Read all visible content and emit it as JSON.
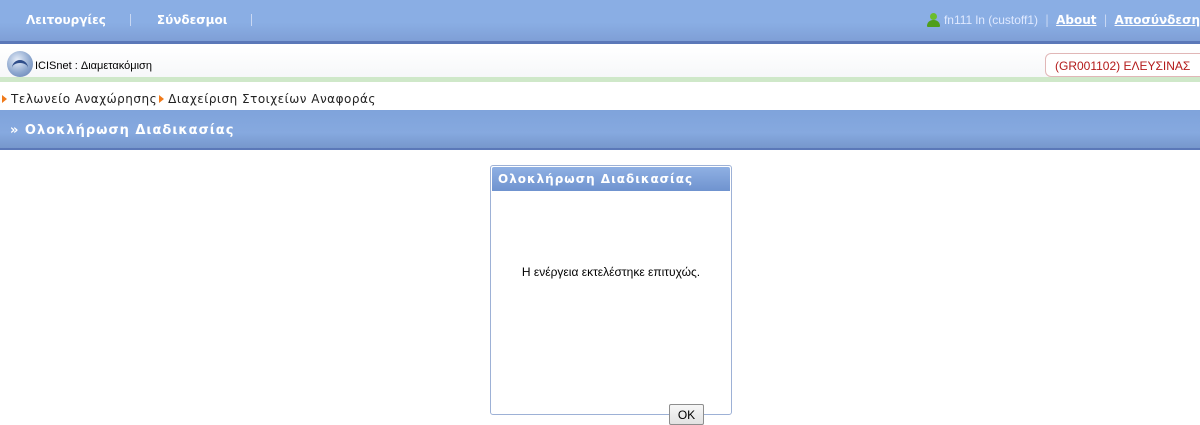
{
  "topbar": {
    "menu": [
      {
        "label": "Λειτουργίες"
      },
      {
        "label": "Σύνδεσμοι"
      }
    ],
    "user": "fn111 ln (custoff1)",
    "about": "About",
    "logout": "Αποσύνδεση"
  },
  "app": {
    "title": "ICISnet : Διαμετακόμιση",
    "office": "(GR001102) ΕΛΕΥΣΙΝΑΣ"
  },
  "breadcrumb": [
    "Τελωνείο Αναχώρησης",
    "Διαχείριση Στοιχείων Αναφοράς"
  ],
  "section": {
    "title": "» Ολοκλήρωση Διαδικασίας"
  },
  "dialog": {
    "title": "Ολοκλήρωση Διαδικασίας",
    "message": "Η ενέργεια εκτελέστηκε επιτυχώς.",
    "ok_label": "OK"
  },
  "colors": {
    "topbar": "#8aaee4",
    "section_bar": "#7fa3db",
    "office_text": "#b31b1b",
    "breadcrumb_arrow": "#f07a1a"
  }
}
